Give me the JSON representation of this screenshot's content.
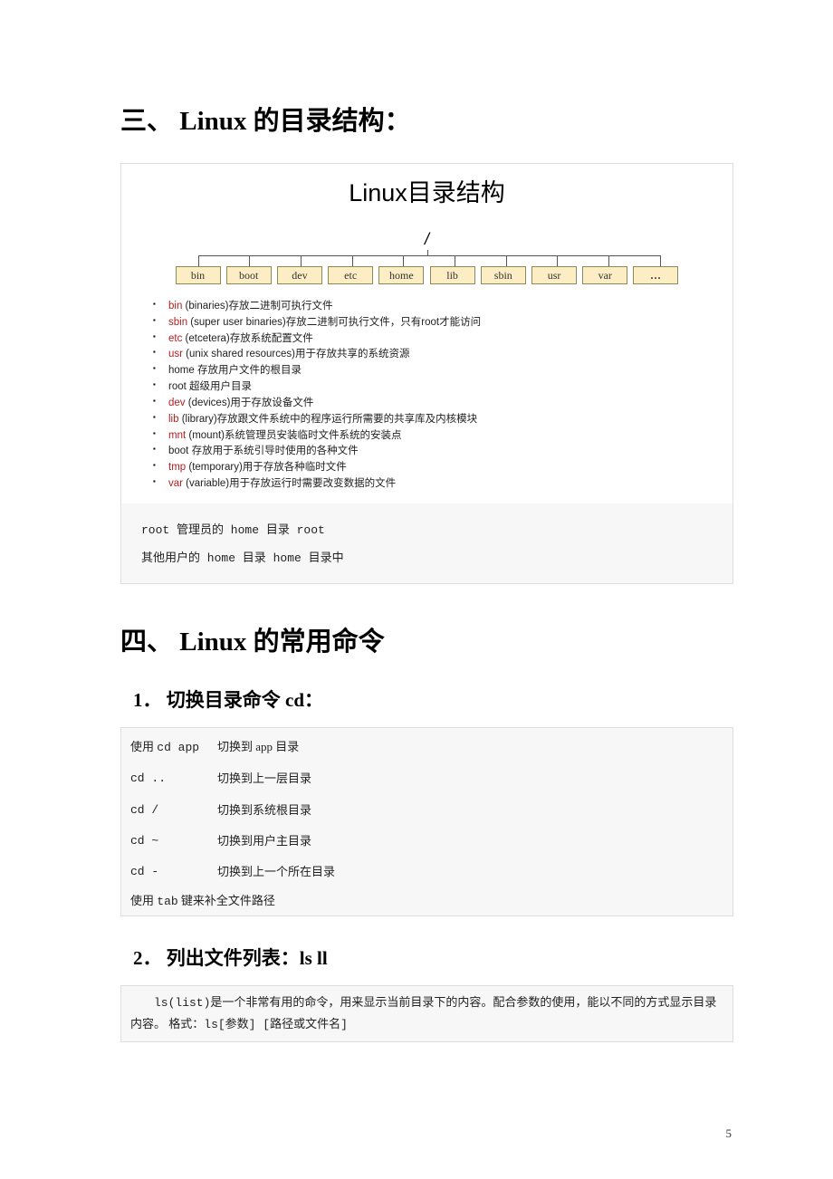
{
  "section3": {
    "heading": "三、 Linux 的目录结构：",
    "diagram": {
      "title": "Linux目录结构",
      "root": "/",
      "dirs": [
        "bin",
        "boot",
        "dev",
        "etc",
        "home",
        "lib",
        "sbin",
        "usr",
        "var",
        "..."
      ],
      "descriptions": [
        {
          "hl": "bin",
          "rest": " (binaries)存放二进制可执行文件"
        },
        {
          "hl": "sbin",
          "rest": " (super user binaries)存放二进制可执行文件，只有root才能访问"
        },
        {
          "hl": "etc",
          "rest": " (etcetera)存放系统配置文件"
        },
        {
          "hl": "usr",
          "rest": " (unix shared resources)用于存放共享的系统资源"
        },
        {
          "plain": "home 存放用户文件的根目录"
        },
        {
          "plain": "root 超级用户目录"
        },
        {
          "hl": "dev",
          "rest": " (devices)用于存放设备文件"
        },
        {
          "hl": "lib",
          "rest": " (library)存放跟文件系统中的程序运行所需要的共享库及内核模块"
        },
        {
          "hl": "mnt",
          "rest": " (mount)系统管理员安装临时文件系统的安装点"
        },
        {
          "plain": "boot 存放用于系统引导时使用的各种文件"
        },
        {
          "hl": "tmp",
          "rest": " (temporary)用于存放各种临时文件"
        },
        {
          "hl": "var",
          "rest": " (variable)用于存放运行时需要改变数据的文件"
        }
      ]
    },
    "notes": [
      "root 管理员的 home 目录 root",
      "其他用户的 home 目录 home 目录中"
    ]
  },
  "section4": {
    "heading": "四、 Linux 的常用命令",
    "sub1": {
      "heading": "1． 切换目录命令 cd：",
      "rows": [
        {
          "cmd_prefix": "使用 ",
          "cmd": "cd app",
          "desc": "切换到 app 目录"
        },
        {
          "cmd": "cd ..",
          "desc": "切换到上一层目录"
        },
        {
          "cmd": "cd /",
          "desc": "切换到系统根目录"
        },
        {
          "cmd": "cd ~",
          "desc": "切换到用户主目录"
        },
        {
          "cmd": "cd -",
          "desc": "切换到上一个所在目录"
        }
      ],
      "footer_pre": "使用 ",
      "footer_mono": "tab",
      "footer_post": " 键来补全文件路径"
    },
    "sub2": {
      "heading": "2． 列出文件列表：ls ll",
      "para_a": "ls(list)",
      "para_b": "是一个非常有用的命令，用来显示当前目录下的内容。配合参数的使用，能以不同的方式显示目录内容。    格式：",
      "para_c": "ls[参数] [路径或文件名]"
    }
  },
  "page_number": "5"
}
